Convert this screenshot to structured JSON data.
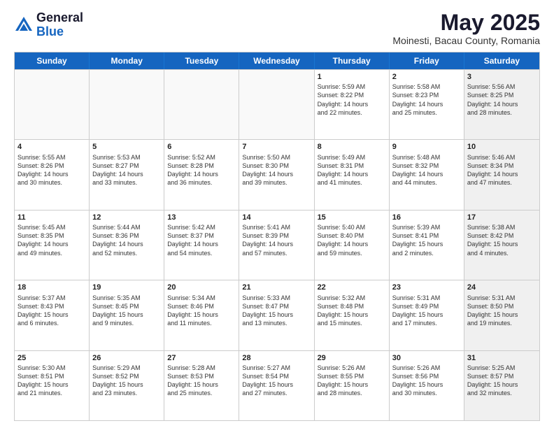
{
  "header": {
    "logo": {
      "general": "General",
      "blue": "Blue"
    },
    "month": "May 2025",
    "location": "Moinesti, Bacau County, Romania"
  },
  "days": [
    "Sunday",
    "Monday",
    "Tuesday",
    "Wednesday",
    "Thursday",
    "Friday",
    "Saturday"
  ],
  "rows": [
    [
      {
        "num": "",
        "empty": true,
        "info": ""
      },
      {
        "num": "",
        "empty": true,
        "info": ""
      },
      {
        "num": "",
        "empty": true,
        "info": ""
      },
      {
        "num": "",
        "empty": true,
        "info": ""
      },
      {
        "num": "1",
        "empty": false,
        "info": "Sunrise: 5:59 AM\nSunset: 8:22 PM\nDaylight: 14 hours\nand 22 minutes."
      },
      {
        "num": "2",
        "empty": false,
        "info": "Sunrise: 5:58 AM\nSunset: 8:23 PM\nDaylight: 14 hours\nand 25 minutes."
      },
      {
        "num": "3",
        "empty": false,
        "shaded": true,
        "info": "Sunrise: 5:56 AM\nSunset: 8:25 PM\nDaylight: 14 hours\nand 28 minutes."
      }
    ],
    [
      {
        "num": "4",
        "empty": false,
        "info": "Sunrise: 5:55 AM\nSunset: 8:26 PM\nDaylight: 14 hours\nand 30 minutes."
      },
      {
        "num": "5",
        "empty": false,
        "info": "Sunrise: 5:53 AM\nSunset: 8:27 PM\nDaylight: 14 hours\nand 33 minutes."
      },
      {
        "num": "6",
        "empty": false,
        "info": "Sunrise: 5:52 AM\nSunset: 8:28 PM\nDaylight: 14 hours\nand 36 minutes."
      },
      {
        "num": "7",
        "empty": false,
        "info": "Sunrise: 5:50 AM\nSunset: 8:30 PM\nDaylight: 14 hours\nand 39 minutes."
      },
      {
        "num": "8",
        "empty": false,
        "info": "Sunrise: 5:49 AM\nSunset: 8:31 PM\nDaylight: 14 hours\nand 41 minutes."
      },
      {
        "num": "9",
        "empty": false,
        "info": "Sunrise: 5:48 AM\nSunset: 8:32 PM\nDaylight: 14 hours\nand 44 minutes."
      },
      {
        "num": "10",
        "empty": false,
        "shaded": true,
        "info": "Sunrise: 5:46 AM\nSunset: 8:34 PM\nDaylight: 14 hours\nand 47 minutes."
      }
    ],
    [
      {
        "num": "11",
        "empty": false,
        "info": "Sunrise: 5:45 AM\nSunset: 8:35 PM\nDaylight: 14 hours\nand 49 minutes."
      },
      {
        "num": "12",
        "empty": false,
        "info": "Sunrise: 5:44 AM\nSunset: 8:36 PM\nDaylight: 14 hours\nand 52 minutes."
      },
      {
        "num": "13",
        "empty": false,
        "info": "Sunrise: 5:42 AM\nSunset: 8:37 PM\nDaylight: 14 hours\nand 54 minutes."
      },
      {
        "num": "14",
        "empty": false,
        "info": "Sunrise: 5:41 AM\nSunset: 8:39 PM\nDaylight: 14 hours\nand 57 minutes."
      },
      {
        "num": "15",
        "empty": false,
        "info": "Sunrise: 5:40 AM\nSunset: 8:40 PM\nDaylight: 14 hours\nand 59 minutes."
      },
      {
        "num": "16",
        "empty": false,
        "info": "Sunrise: 5:39 AM\nSunset: 8:41 PM\nDaylight: 15 hours\nand 2 minutes."
      },
      {
        "num": "17",
        "empty": false,
        "shaded": true,
        "info": "Sunrise: 5:38 AM\nSunset: 8:42 PM\nDaylight: 15 hours\nand 4 minutes."
      }
    ],
    [
      {
        "num": "18",
        "empty": false,
        "info": "Sunrise: 5:37 AM\nSunset: 8:43 PM\nDaylight: 15 hours\nand 6 minutes."
      },
      {
        "num": "19",
        "empty": false,
        "info": "Sunrise: 5:35 AM\nSunset: 8:45 PM\nDaylight: 15 hours\nand 9 minutes."
      },
      {
        "num": "20",
        "empty": false,
        "info": "Sunrise: 5:34 AM\nSunset: 8:46 PM\nDaylight: 15 hours\nand 11 minutes."
      },
      {
        "num": "21",
        "empty": false,
        "info": "Sunrise: 5:33 AM\nSunset: 8:47 PM\nDaylight: 15 hours\nand 13 minutes."
      },
      {
        "num": "22",
        "empty": false,
        "info": "Sunrise: 5:32 AM\nSunset: 8:48 PM\nDaylight: 15 hours\nand 15 minutes."
      },
      {
        "num": "23",
        "empty": false,
        "info": "Sunrise: 5:31 AM\nSunset: 8:49 PM\nDaylight: 15 hours\nand 17 minutes."
      },
      {
        "num": "24",
        "empty": false,
        "shaded": true,
        "info": "Sunrise: 5:31 AM\nSunset: 8:50 PM\nDaylight: 15 hours\nand 19 minutes."
      }
    ],
    [
      {
        "num": "25",
        "empty": false,
        "info": "Sunrise: 5:30 AM\nSunset: 8:51 PM\nDaylight: 15 hours\nand 21 minutes."
      },
      {
        "num": "26",
        "empty": false,
        "info": "Sunrise: 5:29 AM\nSunset: 8:52 PM\nDaylight: 15 hours\nand 23 minutes."
      },
      {
        "num": "27",
        "empty": false,
        "info": "Sunrise: 5:28 AM\nSunset: 8:53 PM\nDaylight: 15 hours\nand 25 minutes."
      },
      {
        "num": "28",
        "empty": false,
        "info": "Sunrise: 5:27 AM\nSunset: 8:54 PM\nDaylight: 15 hours\nand 27 minutes."
      },
      {
        "num": "29",
        "empty": false,
        "info": "Sunrise: 5:26 AM\nSunset: 8:55 PM\nDaylight: 15 hours\nand 28 minutes."
      },
      {
        "num": "30",
        "empty": false,
        "info": "Sunrise: 5:26 AM\nSunset: 8:56 PM\nDaylight: 15 hours\nand 30 minutes."
      },
      {
        "num": "31",
        "empty": false,
        "shaded": true,
        "info": "Sunrise: 5:25 AM\nSunset: 8:57 PM\nDaylight: 15 hours\nand 32 minutes."
      }
    ]
  ]
}
